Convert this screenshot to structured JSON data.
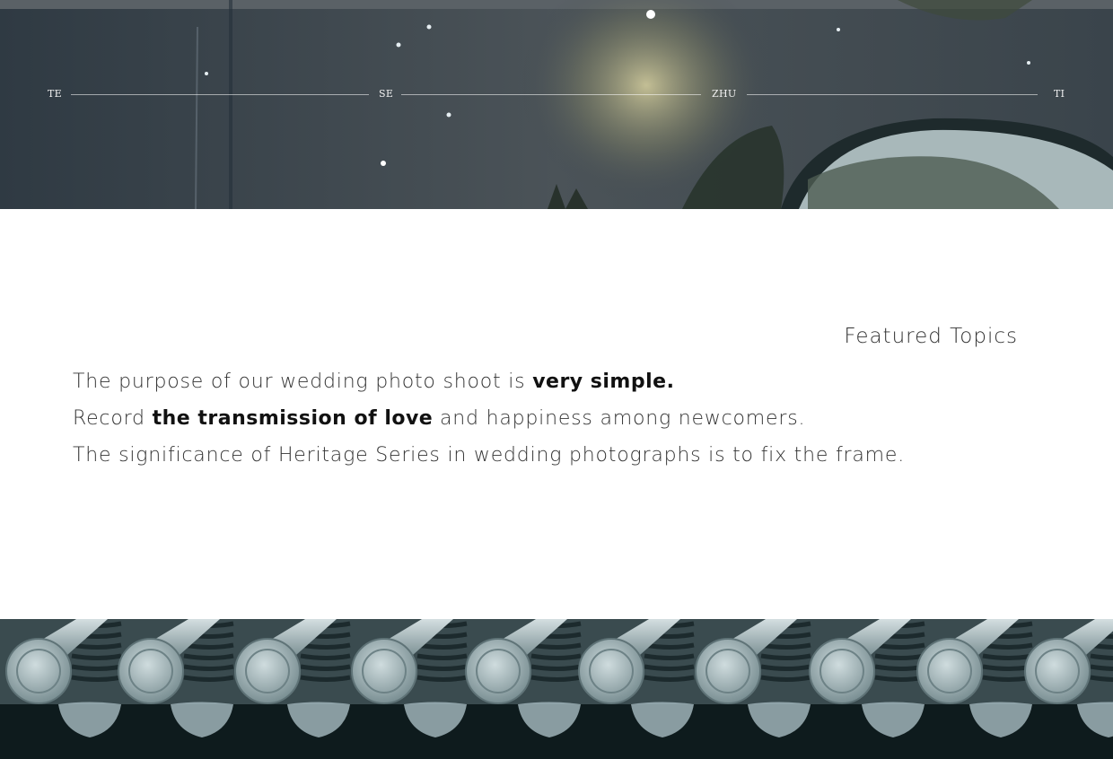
{
  "hero": {
    "steps": [
      "TE",
      "SE",
      "ZHU",
      "TI"
    ]
  },
  "topics": {
    "title": "Featured Topics"
  },
  "intro": {
    "line1": {
      "before": "The purpose of our wedding photo shoot is ",
      "strong": "very simple.",
      "after": ""
    },
    "line2": {
      "before": "Record ",
      "strong": "the transmission of love",
      "after": " and happiness among newcomers."
    },
    "line3": {
      "before": "The significance of Heritage Series in wedding photographs is to fix the frame.",
      "strong": "",
      "after": ""
    }
  },
  "colors": {
    "accent_text": "#333333",
    "hero_dark": "#2d373f",
    "roof_tile": "#9fb3b8"
  }
}
